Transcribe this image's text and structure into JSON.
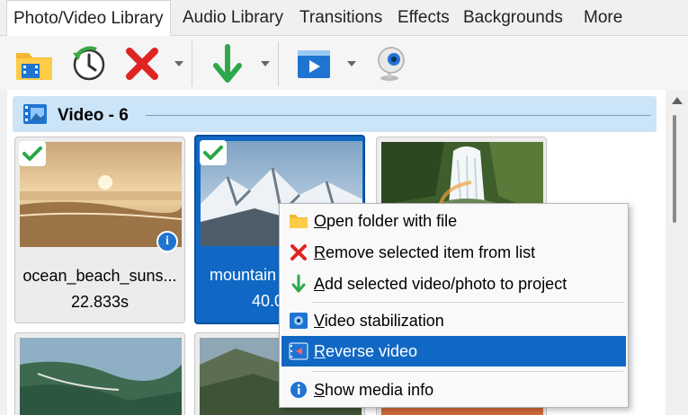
{
  "tabs": [
    {
      "label": "Photo/Video Library",
      "active": true
    },
    {
      "label": "Audio Library"
    },
    {
      "label": "Transitions"
    },
    {
      "label": "Effects"
    },
    {
      "label": "Backgrounds"
    },
    {
      "label": "More"
    }
  ],
  "toolbar": {
    "buttons": [
      "folder-film-icon",
      "clock-refresh-icon",
      "red-x-icon",
      "green-down-arrow-icon",
      "video-play-icon",
      "webcam-icon"
    ]
  },
  "group": {
    "title": "Video - 6"
  },
  "cards": [
    {
      "name": "ocean_beach_suns...",
      "duration": "22.833s",
      "checked": true,
      "selected": false,
      "info": true
    },
    {
      "name": "mountain",
      "duration": "40.0",
      "checked": true,
      "selected": true,
      "info": false
    },
    {
      "name": "",
      "duration": "",
      "checked": false,
      "selected": false,
      "info": false
    }
  ],
  "context_menu": {
    "items": [
      {
        "mnemonic": "O",
        "rest": "pen folder with file",
        "icon": "folder-icon"
      },
      {
        "mnemonic": "R",
        "rest": "emove selected item from list",
        "icon": "red-x-icon"
      },
      {
        "mnemonic": "A",
        "rest": "dd selected video/photo to project",
        "icon": "green-down-arrow-icon"
      },
      {
        "mnemonic": "V",
        "rest": "ideo stabilization",
        "icon": "stabilization-icon"
      },
      {
        "mnemonic": "R",
        "rest": "everse video",
        "icon": "reverse-video-icon",
        "highlighted": true
      },
      {
        "mnemonic": "S",
        "rest": "how media info",
        "icon": "info-icon"
      }
    ]
  },
  "colors": {
    "accent": "#1068c4",
    "group_header": "#cce4f7"
  }
}
